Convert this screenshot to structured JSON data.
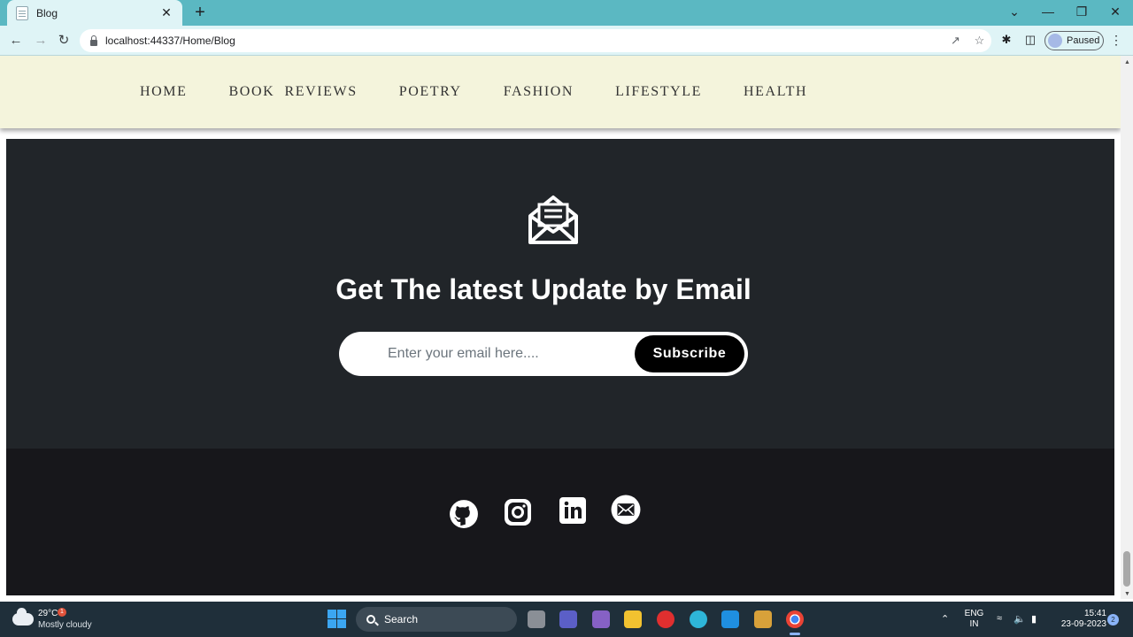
{
  "browser": {
    "tab_title": "Blog",
    "tab_close": "✕",
    "new_tab": "+",
    "url": "localhost:44337/Home/Blog",
    "profile_label": "Paused",
    "window_controls": [
      "⌄",
      "—",
      "❐",
      "✕"
    ]
  },
  "site": {
    "nav_items": [
      "HOME",
      "BOOK  REVIEWS",
      "POETRY",
      "FASHION",
      "LIFESTYLE",
      "HEALTH"
    ]
  },
  "newsletter": {
    "title": "Get The latest Update by Email",
    "input_placeholder": "Enter your email here....",
    "button_label": "Subscribe",
    "icon": "envelope-open-icon"
  },
  "footer": {
    "social_icons": [
      "github-icon",
      "instagram-icon",
      "linkedin-icon",
      "mail-icon"
    ]
  },
  "taskbar": {
    "weather_temp": "29°C",
    "weather_desc": "Mostly cloudy",
    "weather_badge": "1",
    "search_label": "Search",
    "lang_line1": "ENG",
    "lang_line2": "IN",
    "time": "15:41",
    "date": "23-09-2023",
    "notification_count": "2"
  },
  "colors": {
    "tab_strip": "#5bb8c2",
    "nav_background": "#f4f4dc",
    "newsletter_background": "#212529",
    "footer_background": "#17171b",
    "subscribe_button": "#000000"
  }
}
